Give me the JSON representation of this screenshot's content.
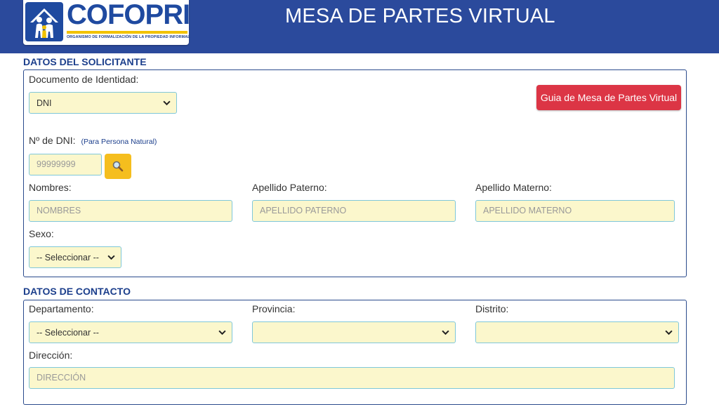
{
  "header": {
    "logo_name": "COFOPRI",
    "logo_subtitle": "ORGANISMO DE FORMALIZACIÓN DE LA PROPIEDAD INFORMAL",
    "title": "MESA DE PARTES VIRTUAL"
  },
  "solicitante": {
    "section_title": "DATOS DEL SOLICITANTE",
    "documento_label": "Documento de Identidad:",
    "documento_value": "DNI",
    "guide_button": "Guia de Mesa de Partes Virtual",
    "dni_label": "Nº de DNI:",
    "dni_note": "(Para Persona Natural)",
    "dni_placeholder": "99999999",
    "nombres_label": "Nombres:",
    "nombres_placeholder": "NOMBRES",
    "paterno_label": "Apellido Paterno:",
    "paterno_placeholder": "APELLIDO PATERNO",
    "materno_label": "Apellido Materno:",
    "materno_placeholder": "APELLIDO MATERNO",
    "sexo_label": "Sexo:",
    "sexo_value": "-- Seleccionar --"
  },
  "contacto": {
    "section_title": "DATOS DE CONTACTO",
    "departamento_label": "Departamento:",
    "departamento_value": "-- Seleccionar --",
    "provincia_label": "Provincia:",
    "provincia_value": "",
    "distrito_label": "Distrito:",
    "distrito_value": "",
    "direccion_label": "Dirección:",
    "direccion_placeholder": "DIRECCIÓN"
  },
  "icons": {
    "chevron": "chevron-down-icon",
    "search": "magnifier-icon",
    "logo": "family-house-icon"
  },
  "colors": {
    "header_bg": "#2b4a9c",
    "field_bg": "#fbf7cc",
    "guide_button_bg": "#dc3545",
    "search_button_bg": "#f5be1e",
    "section_title": "#1c3f8c"
  }
}
